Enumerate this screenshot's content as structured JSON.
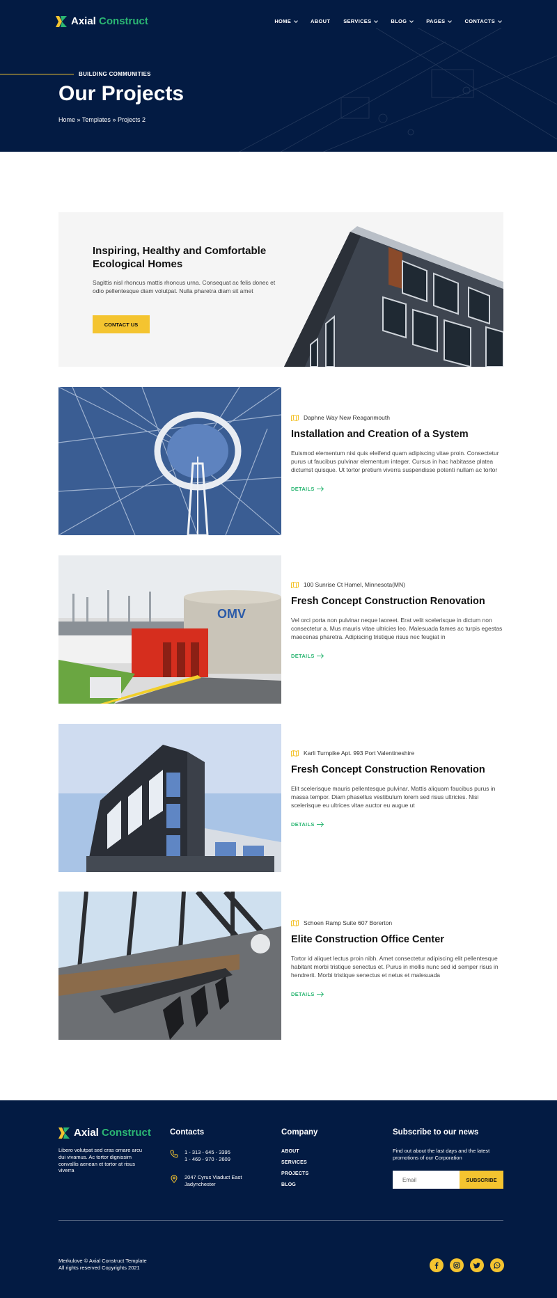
{
  "header": {
    "brand_primary": "Axial",
    "brand_accent": "Construct",
    "nav": [
      {
        "label": "HOME",
        "has_dropdown": true
      },
      {
        "label": "ABOUT",
        "has_dropdown": false
      },
      {
        "label": "SERVICES",
        "has_dropdown": true
      },
      {
        "label": "BLOG",
        "has_dropdown": true
      },
      {
        "label": "PAGES",
        "has_dropdown": true
      },
      {
        "label": "CONTACTS",
        "has_dropdown": true
      }
    ],
    "eyebrow": "BUILDING COMMUNITIES",
    "title": "Our Projects",
    "breadcrumb": [
      "Home",
      "Templates",
      "Projects 2"
    ],
    "breadcrumb_separator": "»"
  },
  "feature": {
    "title": "Inspiring, Healthy and Comfortable Ecological Homes",
    "text": "Sagittis nisl rhoncus mattis rhoncus urna. Consequat ac felis donec et odio pellentesque diam volutpat. Nulla pharetra diam sit amet",
    "button_label": "CONTACT US"
  },
  "projects": [
    {
      "location": "Daphne Way New Reaganmouth",
      "title": "Installation and Creation of a System",
      "text": "Euismod elementum nisi quis eleifend quam adipiscing vitae proin. Consectetur purus ut faucibus pulvinar elementum integer. Cursus in hac habitasse platea dictumst quisque. Ut tortor pretium viverra suspendisse potenti nullam ac tortor",
      "link_label": "DETAILS"
    },
    {
      "location": "100 Sunrise Ct Hamel, Minnesota(MN)",
      "title": "Fresh Concept Construction Renovation",
      "text": "Vel orci porta non pulvinar neque laoreet. Erat velit scelerisque in dictum non consectetur a. Mus mauris vitae ultricies leo. Malesuada fames ac turpis egestas maecenas pharetra. Adipiscing tristique risus nec feugiat in",
      "link_label": "DETAILS"
    },
    {
      "location": "Karli Turnpike Apt. 993 Port Valentineshire",
      "title": "Fresh Concept Construction Renovation",
      "text": "Elit scelerisque mauris pellentesque pulvinar. Mattis aliquam faucibus purus in massa tempor. Diam phasellus vestibulum lorem sed risus ultricies. Nisi scelerisque eu ultrices vitae auctor eu augue ut",
      "link_label": "DETAILS"
    },
    {
      "location": "Schoen Ramp Suite 607 Borerton",
      "title": "Elite Construction Office Center",
      "text": "Tortor id aliquet lectus proin nibh. Amet consectetur adipiscing elit pellentesque habitant morbi tristique senectus et. Purus in mollis nunc sed id semper risus in hendrerit. Morbi tristique senectus et netus et malesuada",
      "link_label": "DETAILS"
    }
  ],
  "footer": {
    "about": "Libero volutpat sed cras ornare arcu dui vivamus. Ac tortor dignissim convallis aenean et tortor at risus viverra",
    "contacts_heading": "Contacts",
    "phone_1": "1 - 313 - 645 - 3395",
    "phone_2": "1 - 469 - 970 - 2609",
    "address_1": "2047 Cyrus Viaduct East",
    "address_2": "Jadynchester",
    "company_heading": "Company",
    "company_links": [
      "ABOUT",
      "SERVICES",
      "PROJECTS",
      "BLOG"
    ],
    "subscribe_heading": "Subscribe to our news",
    "subscribe_text": "Find out about the last days and the latest promotions of our Corporation",
    "email_placeholder": "Email",
    "subscribe_button": "SUBSCRIBE",
    "copyright_1": "Merkulove © Axial Construct Template",
    "copyright_2": "All rights reserved Copyrights 2021",
    "socials": [
      "facebook-icon",
      "instagram-icon",
      "twitter-icon",
      "whatsapp-icon"
    ]
  },
  "colors": {
    "navy": "#031b43",
    "accent_green": "#2bb673",
    "accent_yellow": "#f4c430",
    "banner_bg": "#f5f5f5"
  }
}
